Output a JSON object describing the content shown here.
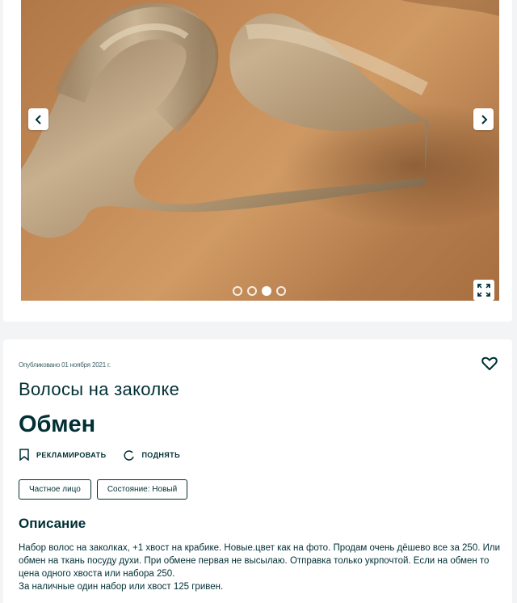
{
  "gallery": {
    "photo_alt": "Волосы на заколке",
    "dots": [
      false,
      false,
      true,
      false
    ],
    "icons": {
      "prev": "chevron-left-icon",
      "next": "chevron-right-icon",
      "expand": "expand-icon"
    }
  },
  "ad": {
    "published": "Опубликовано 01 ноября 2021 г.",
    "title": "Волосы на заколке",
    "price": "Обмен",
    "actions": {
      "promote": "РЕКЛАМИРОВАТЬ",
      "raise": "ПОДНЯТЬ"
    },
    "tags": {
      "seller_type": "Частное лицо",
      "condition": "Состояние: Новый"
    },
    "description_heading": "Описание",
    "description": "Набор волос на заколках, +1 хвост на крабике. Новые.цвет как на фото. Продам очень дёшево все за 250. Или обмен на ткань посуду духи. При обмене первая не высылаю. Отправка только укрпочтой. Если на обмен то цена одного хвоста или набора 250.\nЗа наличные один набор или хвост 125 гривен."
  }
}
